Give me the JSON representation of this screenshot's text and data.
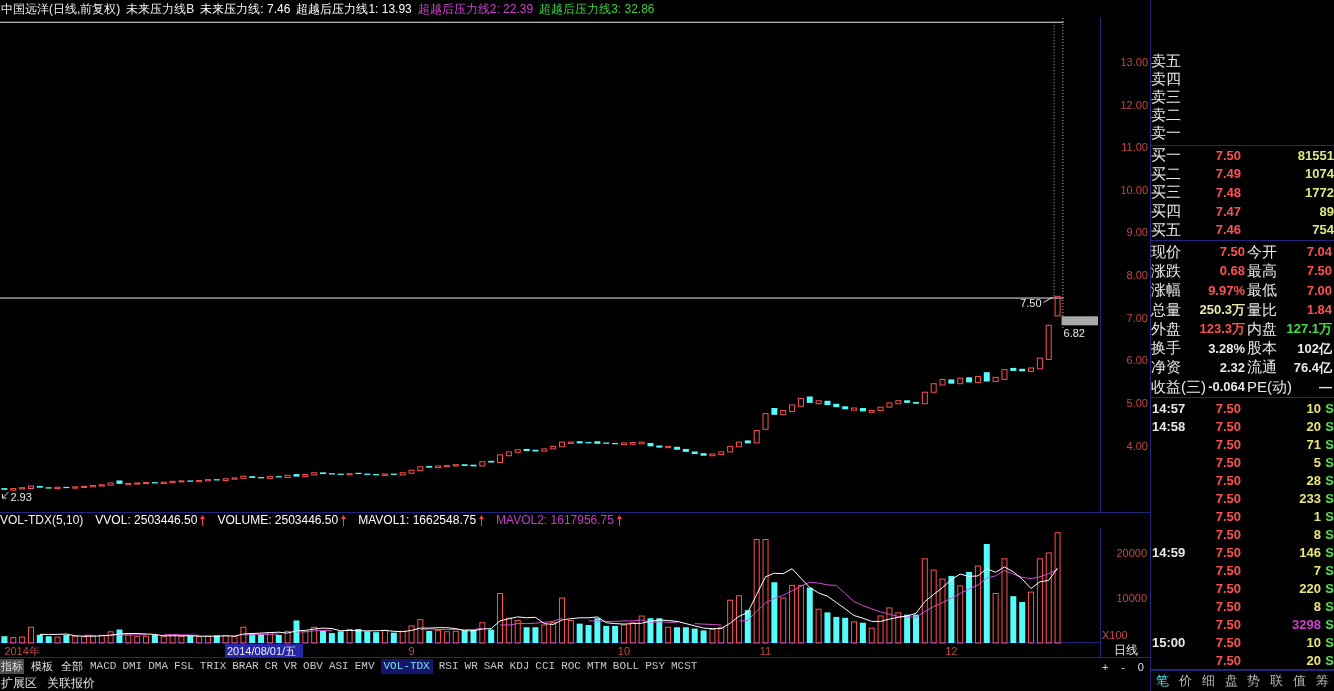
{
  "chart_header": {
    "title": "中国远洋(日线,前复权)",
    "indicator": "未来压力线B",
    "values": [
      {
        "text": "未来压力线: 7.46",
        "color": "#ffffff"
      },
      {
        "text": "超越后压力线1: 13.93",
        "color": "#ffffff"
      },
      {
        "text": "超越后压力线2: 22.39",
        "color": "#d040d0"
      },
      {
        "text": "超越后压力线3: 32.86",
        "color": "#40d040"
      }
    ]
  },
  "price_chart": {
    "axis_labels": [
      "13.00",
      "12.00",
      "11.00",
      "10.00",
      "9.00",
      "8.00",
      "7.00",
      "6.00",
      "5.00",
      "4.00"
    ],
    "price_labels": [
      "7.50",
      "6.82",
      "2.93"
    ]
  },
  "volume_header": {
    "title": "VOL-TDX(5,10)",
    "items": [
      {
        "text": "VVOL: 2503446.50",
        "color": "#ffffff",
        "rising": true
      },
      {
        "text": "VOLUME: 2503446.50",
        "color": "#ffffff",
        "rising": true
      },
      {
        "text": "MAVOL1: 1662548.75",
        "color": "#ffffff",
        "rising": true
      },
      {
        "text": "MAVOL2: 1617956.75",
        "color": "#c040c0",
        "rising": true
      }
    ]
  },
  "volume_chart": {
    "chart_data": {
      "type": "bar",
      "ylabel": "X100",
      "ylim": [
        0,
        25550
      ],
      "yticks": [
        {
          "value": 10000,
          "label": "10000"
        },
        {
          "value": 20000,
          "label": "20000"
        }
      ],
      "categories": [
        null,
        null,
        "2014年",
        null,
        null,
        null,
        null,
        null,
        null,
        null,
        null,
        null,
        null,
        null,
        null,
        null,
        null,
        null,
        null,
        null,
        null,
        null,
        null,
        null,
        null,
        null,
        null,
        null,
        null,
        null,
        null,
        null,
        null,
        null,
        null,
        null,
        null,
        null,
        null,
        null,
        null,
        null,
        null,
        null,
        null,
        null,
        "9",
        null,
        null,
        null,
        null,
        null,
        null,
        null,
        null,
        null,
        null,
        null,
        null,
        null,
        null,
        null,
        null,
        null,
        null,
        null,
        null,
        null,
        null,
        null,
        "10",
        null,
        null,
        null,
        null,
        null,
        null,
        null,
        null,
        null,
        null,
        null,
        null,
        null,
        null,
        null,
        "11",
        null,
        null,
        null,
        null,
        null,
        null,
        null,
        null,
        null,
        null,
        null,
        null,
        null,
        null,
        null,
        null,
        null,
        null,
        null,
        null,
        "12",
        null,
        null,
        null,
        null,
        null,
        null,
        null,
        null,
        null,
        null,
        null,
        null
      ],
      "series": [
        {
          "type": "bar",
          "values": [
            1500,
            1200,
            1300,
            3500,
            1800,
            1500,
            1300,
            1800,
            1500,
            1400,
            1600,
            1700,
            2500,
            3000,
            1800,
            1400,
            1500,
            1800,
            1500,
            1700,
            1500,
            1600,
            1400,
            1500,
            1700,
            1600,
            1500,
            3500,
            2200,
            2000,
            2300,
            1800,
            2600,
            5000,
            2500,
            3500,
            2700,
            2200,
            2600,
            3000,
            3100,
            2600,
            2400,
            2800,
            2300,
            2600,
            3800,
            5200,
            2700,
            2800,
            2500,
            2600,
            2800,
            3000,
            4500,
            3000,
            11000,
            5500,
            5000,
            3500,
            3500,
            4000,
            4500,
            10000,
            5000,
            4300,
            4000,
            5500,
            3800,
            3800,
            4000,
            4500,
            6000,
            5500,
            5500,
            3500,
            3500,
            3500,
            3200,
            2800,
            3000,
            3500,
            9500,
            10500,
            7300,
            23000,
            23000,
            13500,
            10000,
            12800,
            12800,
            12300,
            7500,
            6800,
            5800,
            5600,
            4700,
            4500,
            3300,
            6000,
            7800,
            6700,
            6300,
            6300,
            18700,
            16200,
            14200,
            14900,
            12700,
            15800,
            17100,
            22000,
            11000,
            18700,
            10400,
            9100,
            11300,
            18700,
            20000,
            24500
          ],
          "colors": [
            "#54fcfc",
            "#ff5050",
            "#ff5050",
            "#ff5050",
            "#54fcfc",
            "#54fcfc",
            "#ff5050",
            "#54fcfc",
            "#ff5050",
            "#ff5050",
            "#ff5050",
            "#ff5050",
            "#ff5050",
            "#54fcfc",
            "#ff5050",
            "#ff5050",
            "#ff5050",
            "#54fcfc",
            "#ff5050",
            "#ff5050",
            "#ff5050",
            "#54fcfc",
            "#ff5050",
            "#ff5050",
            "#54fcfc",
            "#ff5050",
            "#ff5050",
            "#ff5050",
            "#54fcfc",
            "#54fcfc",
            "#ff5050",
            "#54fcfc",
            "#ff5050",
            "#54fcfc",
            "#ff5050",
            "#ff5050",
            "#54fcfc",
            "#54fcfc",
            "#54fcfc",
            "#ff5050",
            "#54fcfc",
            "#54fcfc",
            "#54fcfc",
            "#ff5050",
            "#54fcfc",
            "#ff5050",
            "#ff5050",
            "#ff5050",
            "#54fcfc",
            "#ff5050",
            "#ff5050",
            "#ff5050",
            "#54fcfc",
            "#54fcfc",
            "#ff5050",
            "#54fcfc",
            "#ff5050",
            "#ff5050",
            "#ff5050",
            "#54fcfc",
            "#54fcfc",
            "#ff5050",
            "#ff5050",
            "#ff5050",
            "#ff5050",
            "#54fcfc",
            "#54fcfc",
            "#54fcfc",
            "#54fcfc",
            "#54fcfc",
            "#ff5050",
            "#ff5050",
            "#ff5050",
            "#54fcfc",
            "#54fcfc",
            "#ff5050",
            "#54fcfc",
            "#54fcfc",
            "#54fcfc",
            "#54fcfc",
            "#ff5050",
            "#ff5050",
            "#ff5050",
            "#ff5050",
            "#54fcfc",
            "#ff5050",
            "#ff5050",
            "#54fcfc",
            "#ff5050",
            "#ff5050",
            "#ff5050",
            "#54fcfc",
            "#ff5050",
            "#54fcfc",
            "#54fcfc",
            "#54fcfc",
            "#ff5050",
            "#54fcfc",
            "#ff5050",
            "#ff5050",
            "#ff5050",
            "#ff5050",
            "#54fcfc",
            "#54fcfc",
            "#ff5050",
            "#ff5050",
            "#ff5050",
            "#54fcfc",
            "#ff5050",
            "#54fcfc",
            "#ff5050",
            "#54fcfc",
            "#ff5050",
            "#ff5050",
            "#54fcfc",
            "#54fcfc",
            "#ff5050",
            "#ff5050",
            "#ff5050",
            "#ff5050"
          ]
        },
        {
          "type": "line",
          "color": "#ffffff",
          "values": [
            null,
            null,
            null,
            null,
            1900,
            1900,
            1900,
            2000,
            1600,
            1500,
            1500,
            1600,
            1700,
            2000,
            2100,
            2100,
            2000,
            1900,
            1600,
            1600,
            1600,
            1600,
            1500,
            1500,
            1500,
            1600,
            1500,
            2000,
            2100,
            2200,
            2300,
            2400,
            2200,
            2700,
            2800,
            3100,
            3300,
            3200,
            2700,
            2800,
            2700,
            2700,
            2700,
            2800,
            2600,
            2500,
            2800,
            3300,
            3300,
            3400,
            3400,
            3200,
            2700,
            2700,
            3100,
            3200,
            4900,
            5400,
            5800,
            5600,
            5700,
            4300,
            4100,
            5100,
            5400,
            5600,
            5600,
            5800,
            4500,
            4300,
            4200,
            4300,
            4400,
            4800,
            5100,
            5000,
            4800,
            4300,
            3800,
            3300,
            3200,
            3200,
            4400,
            5900,
            6800,
            10800,
            14700,
            15500,
            15400,
            16500,
            14400,
            12300,
            11100,
            10400,
            9000,
            7600,
            6100,
            5500,
            4800,
            4800,
            5300,
            5700,
            6000,
            6600,
            9200,
            10800,
            12300,
            14100,
            15300,
            14800,
            14900,
            16500,
            15700,
            16900,
            15800,
            14200,
            12100,
            13600,
            13900,
            16700
          ]
        },
        {
          "type": "line",
          "color": "#d050d0",
          "values": [
            null,
            null,
            null,
            null,
            null,
            null,
            null,
            null,
            null,
            1700,
            1700,
            null,
            1900,
            1800,
            1800,
            1800,
            1800,
            null,
            1800,
            1900,
            1800,
            1800,
            1700,
            null,
            null,
            null,
            null,
            1800,
            1800,
            1900,
            1900,
            2000,
            null,
            2400,
            2500,
            2700,
            2800,
            2700,
            null,
            null,
            null,
            null,
            null,
            null,
            null,
            null,
            null,
            3000,
            3100,
            3000,
            3000,
            3000,
            3000,
            3000,
            3300,
            null,
            4000,
            4000,
            4300,
            4300,
            4400,
            4600,
            4800,
            5500,
            null,
            null,
            4900,
            4900,
            4800,
            4800,
            4900,
            4900,
            5100,
            4600,
            4700,
            4600,
            4600,
            null,
            4300,
            4200,
            4100,
            4000,
            null,
            4900,
            5000,
            7000,
            8900,
            9900,
            10600,
            11600,
            12600,
            13500,
            13300,
            12900,
            12800,
            11000,
            9200,
            8300,
            7600,
            6900,
            6400,
            5900,
            5800,
            5700,
            7000,
            8100,
            9000,
            10000,
            11000,
            12000,
            12900,
            14400,
            14900,
            16100,
            15300,
            14600,
            14300,
            14700,
            15400,
            16300
          ]
        }
      ]
    },
    "cursor_date": "2014/08/01/五",
    "period": "日线"
  },
  "indicator_bar": {
    "modes": [
      {
        "label": "指标",
        "selected": true
      },
      {
        "label": "模板",
        "selected": false
      },
      {
        "label": "全部",
        "selected": false
      }
    ],
    "indicators": [
      {
        "label": "MACD",
        "selected": false
      },
      {
        "label": "DMI",
        "selected": false
      },
      {
        "label": "DMA",
        "selected": false
      },
      {
        "label": "FSL",
        "selected": false
      },
      {
        "label": "TRIX",
        "selected": false
      },
      {
        "label": "BRAR",
        "selected": false
      },
      {
        "label": "CR",
        "selected": false
      },
      {
        "label": "VR",
        "selected": false
      },
      {
        "label": "OBV",
        "selected": false
      },
      {
        "label": "ASI",
        "selected": false
      },
      {
        "label": "EMV",
        "selected": false
      },
      {
        "label": "VOL-TDX",
        "selected": true
      },
      {
        "label": "RSI",
        "selected": false
      },
      {
        "label": "WR",
        "selected": false
      },
      {
        "label": "SAR",
        "selected": false
      },
      {
        "label": "KDJ",
        "selected": false
      },
      {
        "label": "CCI",
        "selected": false
      },
      {
        "label": "ROC",
        "selected": false
      },
      {
        "label": "MTM",
        "selected": false
      },
      {
        "label": "BOLL",
        "selected": false
      },
      {
        "label": "PSY",
        "selected": false
      },
      {
        "label": "MCST",
        "selected": false
      }
    ],
    "zoom_controls": [
      "+",
      "-",
      "0"
    ]
  },
  "bottom_bar": {
    "links": [
      "扩展区",
      "关联报价"
    ]
  },
  "quote_panel": {
    "asks": [
      {
        "label": "卖五"
      },
      {
        "label": "卖四"
      },
      {
        "label": "卖三"
      },
      {
        "label": "卖二"
      },
      {
        "label": "卖一"
      }
    ],
    "bids": [
      {
        "label": "买一",
        "price": "7.50",
        "volume": "81551"
      },
      {
        "label": "买二",
        "price": "7.49",
        "volume": "1074"
      },
      {
        "label": "买三",
        "price": "7.48",
        "volume": "1772"
      },
      {
        "label": "买四",
        "price": "7.47",
        "volume": "89"
      },
      {
        "label": "买五",
        "price": "7.46",
        "volume": "754"
      }
    ],
    "stats": [
      {
        "label": "现价",
        "value": "7.50",
        "color": "#ff5050"
      },
      {
        "label": "今开",
        "value": "7.04",
        "color": "#ff5050"
      },
      {
        "label": "涨跌",
        "value": "0.68",
        "color": "#ff5050"
      },
      {
        "label": "最高",
        "value": "7.50",
        "color": "#ff5050"
      },
      {
        "label": "涨幅",
        "value": "9.97%",
        "color": "#ff5050"
      },
      {
        "label": "最低",
        "value": "7.00",
        "color": "#ff5050"
      },
      {
        "label": "总量",
        "value": "250.3万",
        "color": "#e8e8b0"
      },
      {
        "label": "量比",
        "value": "1.84",
        "color": "#ff5050"
      },
      {
        "label": "外盘",
        "value": "123.3万",
        "color": "#ff5050"
      },
      {
        "label": "内盘",
        "value": "127.1万",
        "color": "#40e040"
      },
      {
        "label": "换手",
        "value": "3.28%",
        "color": "#e8e8e8"
      },
      {
        "label": "股本",
        "value": "102亿",
        "color": "#e8e8e8"
      },
      {
        "label": "净资",
        "value": "2.32",
        "color": "#e8e8e8"
      },
      {
        "label": "流通",
        "value": "76.4亿",
        "color": "#e8e8e8"
      },
      {
        "label": "收益(三)",
        "value": "-0.064",
        "color": "#e8e8e8"
      },
      {
        "label": "PE(动)",
        "value": "—",
        "color": "#e8e8e8"
      }
    ],
    "ticks": [
      {
        "time": "14:57",
        "price": "7.50",
        "volume": "10",
        "side": "S",
        "large": false
      },
      {
        "time": "14:58",
        "price": "7.50",
        "volume": "20",
        "side": "S",
        "large": false
      },
      {
        "price": "7.50",
        "volume": "71",
        "side": "S",
        "large": false
      },
      {
        "price": "7.50",
        "volume": "5",
        "side": "S",
        "large": false
      },
      {
        "price": "7.50",
        "volume": "28",
        "side": "S",
        "large": false
      },
      {
        "price": "7.50",
        "volume": "233",
        "side": "S",
        "large": false
      },
      {
        "price": "7.50",
        "volume": "1",
        "side": "S",
        "large": false
      },
      {
        "price": "7.50",
        "volume": "8",
        "side": "S",
        "large": false
      },
      {
        "time": "14:59",
        "price": "7.50",
        "volume": "146",
        "side": "S",
        "large": false
      },
      {
        "price": "7.50",
        "volume": "7",
        "side": "S",
        "large": false
      },
      {
        "price": "7.50",
        "volume": "220",
        "side": "S",
        "large": false
      },
      {
        "price": "7.50",
        "volume": "8",
        "side": "S",
        "large": false
      },
      {
        "price": "7.50",
        "volume": "3298",
        "side": "S",
        "large": true
      },
      {
        "time": "15:00",
        "price": "7.50",
        "volume": "10",
        "side": "S",
        "large": false
      },
      {
        "price": "7.50",
        "volume": "20",
        "side": "S",
        "large": false
      }
    ],
    "tabs": [
      {
        "label": "笔",
        "selected": true
      },
      {
        "label": "价",
        "selected": false
      },
      {
        "label": "细",
        "selected": false
      },
      {
        "label": "盘",
        "selected": false
      },
      {
        "label": "势",
        "selected": false
      },
      {
        "label": "联",
        "selected": false
      },
      {
        "label": "值",
        "selected": false
      },
      {
        "label": "筹",
        "selected": false
      }
    ]
  }
}
